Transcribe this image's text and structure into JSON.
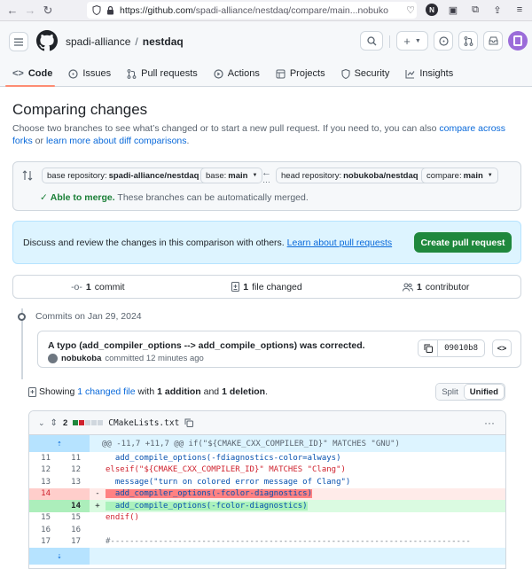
{
  "browser": {
    "url": "https://github.com/spadi-alliance/nestdaq/compare/main...nobuk",
    "url_domain": "https://github.com",
    "url_path": "/spadi-alliance/nestdaq/compare/main...nobuko",
    "avatar_letter": "N"
  },
  "header": {
    "owner": "spadi-alliance",
    "separator": "/",
    "repo": "nestdaq",
    "plus_label": "+"
  },
  "tabs": [
    {
      "label": "Code",
      "icon": "code-icon",
      "active": true
    },
    {
      "label": "Issues",
      "icon": "issue-icon"
    },
    {
      "label": "Pull requests",
      "icon": "pull-request-icon"
    },
    {
      "label": "Actions",
      "icon": "play-icon"
    },
    {
      "label": "Projects",
      "icon": "table-icon"
    },
    {
      "label": "Security",
      "icon": "shield-icon"
    },
    {
      "label": "Insights",
      "icon": "graph-icon"
    }
  ],
  "page": {
    "title": "Comparing changes",
    "desc_1": "Choose two branches to see what’s changed or to start a new pull request. If you need to, you can also ",
    "desc_link_1": "compare across forks",
    "desc_2": " or ",
    "desc_link_2": "learn more about diff comparisons",
    "desc_3": "."
  },
  "compare": {
    "base_repo_label": "base repository: ",
    "base_repo_value": "spadi-alliance/nestdaq",
    "base_label": "base: ",
    "base_value": "main",
    "head_repo_label": "head repository: ",
    "head_repo_value": "nobukoba/nestdaq",
    "compare_label": "compare: ",
    "compare_value": "main",
    "merge_ok": "Able to merge.",
    "merge_text": " These branches can be automatically merged."
  },
  "flash": {
    "text": "Discuss and review the changes in this comparison with others. ",
    "link": "Learn about pull requests",
    "button": "Create pull request"
  },
  "stats": {
    "commits_count": "1",
    "commits_label": " commit",
    "files_count": "1",
    "files_label": " file changed",
    "contrib_count": "1",
    "contrib_label": " contributor"
  },
  "commits": {
    "date": "Commits on Jan 29, 2024",
    "title": "A typo (add_compiler_options --> add_compile_options) was corrected.",
    "author": "nobukoba",
    "meta": "committed 12 minutes ago",
    "sha": "09010b8"
  },
  "summary": {
    "prefix": "Showing ",
    "link": "1 changed file",
    "mid": " with ",
    "add": "1 addition",
    "and": " and ",
    "del": "1 deletion",
    "end": ".",
    "split": "Split",
    "unified": "Unified"
  },
  "file": {
    "count": "2",
    "name": "CMakeLists.txt",
    "hunk": "@@ -11,7 +11,7 @@ if(\"${CMAKE_CXX_COMPILER_ID}\" MATCHES \"GNU\")",
    "lines": [
      {
        "old": "11",
        "new": "11",
        "type": "ctx",
        "code": "  add_compile_options(-fdiagnostics-color=always)"
      },
      {
        "old": "12",
        "new": "12",
        "type": "ctx",
        "code": "elseif(\"${CMAKE_CXX_COMPILER_ID}\" MATCHES \"Clang\")"
      },
      {
        "old": "13",
        "new": "13",
        "type": "ctx",
        "code": "  message(\"turn on colored error message of Clang\")"
      },
      {
        "old": "14",
        "new": "",
        "type": "del",
        "code": "  add_compiler_options(-fcolor-diagnostics)"
      },
      {
        "old": "",
        "new": "14",
        "type": "add",
        "code": "  add_compile_options(-fcolor-diagnostics)"
      },
      {
        "old": "15",
        "new": "15",
        "type": "ctx",
        "code": "endif()"
      },
      {
        "old": "16",
        "new": "16",
        "type": "ctx",
        "code": ""
      },
      {
        "old": "17",
        "new": "17",
        "type": "ctx",
        "code": "#---------------------------------------------------------------------------"
      }
    ]
  },
  "colors": {
    "accent": "#0969da",
    "success": "#1f883d",
    "tab_underline": "#fd8c73"
  }
}
